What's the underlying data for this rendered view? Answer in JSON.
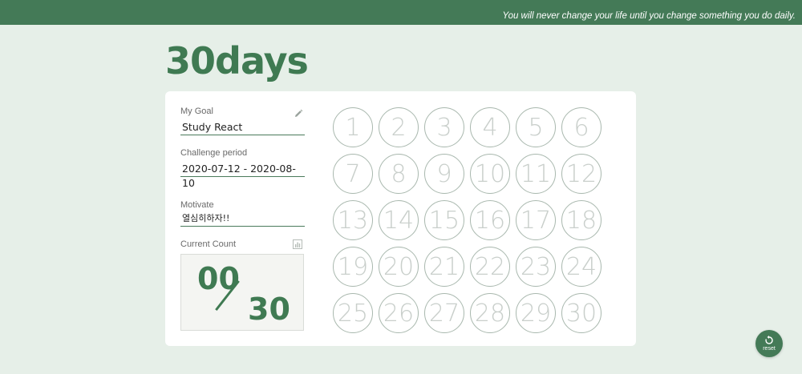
{
  "header": {
    "quote": "You will never change your life until you change something you do daily."
  },
  "app": {
    "title": "30days"
  },
  "form": {
    "goal_label": "My Goal",
    "goal_value": "Study React",
    "period_label": "Challenge period",
    "period_value": "2020-07-12 - 2020-08-10",
    "motivate_label": "Motivate",
    "motivate_value": "열심히하자!!",
    "count_label": "Current Count"
  },
  "count": {
    "current": "00",
    "total": "30"
  },
  "days": [
    "1",
    "2",
    "3",
    "4",
    "5",
    "6",
    "7",
    "8",
    "9",
    "10",
    "11",
    "12",
    "13",
    "14",
    "15",
    "16",
    "17",
    "18",
    "19",
    "20",
    "21",
    "22",
    "23",
    "24",
    "25",
    "26",
    "27",
    "28",
    "29",
    "30"
  ],
  "reset": {
    "label": "reset"
  },
  "colors": {
    "accent": "#447a57",
    "background": "#e6efe8",
    "day_text": "#c9cfcb"
  },
  "icons": {
    "edit": "pencil-icon",
    "stats": "bar-chart-icon",
    "reset": "refresh-icon"
  }
}
